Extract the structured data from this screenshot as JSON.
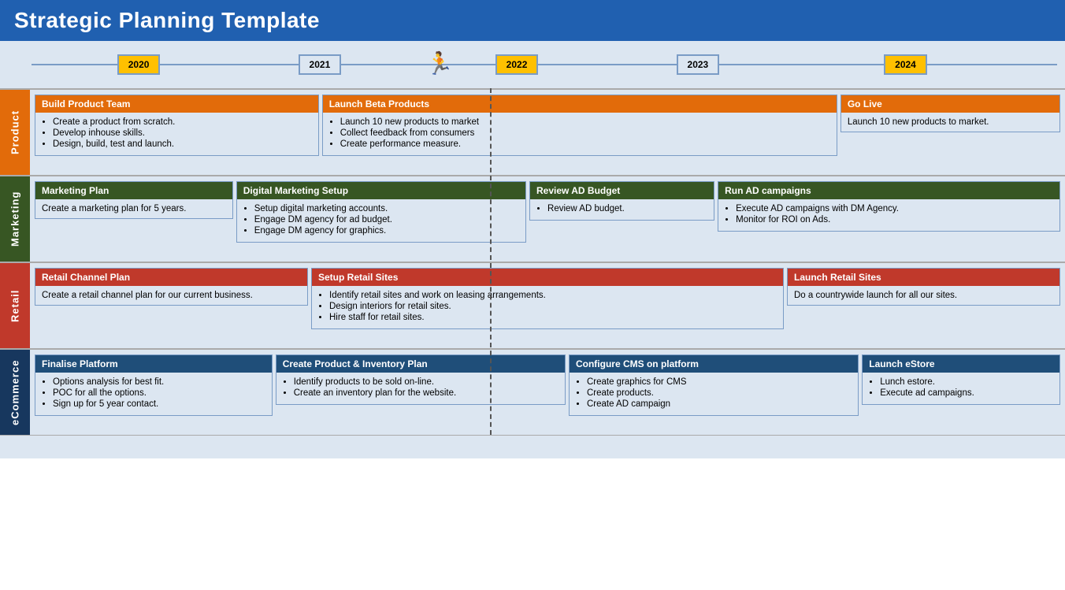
{
  "header": {
    "title": "Strategic Planning Template"
  },
  "timeline": {
    "years": [
      {
        "label": "2020",
        "style": "yellow",
        "left": "14%"
      },
      {
        "label": "2021",
        "style": "blue",
        "left": "31%"
      },
      {
        "label": "2022",
        "style": "yellow",
        "left": "49%"
      },
      {
        "label": "2023",
        "style": "blue",
        "left": "66%"
      },
      {
        "label": "2024",
        "style": "yellow",
        "left": "86%"
      }
    ],
    "runner_left": "42%"
  },
  "dashed_line_left": "44.5%",
  "rows": [
    {
      "id": "product",
      "label": "Product",
      "label_style": "orange",
      "cards": [
        {
          "header": "Build Product Team",
          "header_style": "orange",
          "body_type": "list",
          "items": [
            "Create a product from scratch.",
            "Develop inhouse skills.",
            "Design, build, test and launch."
          ]
        },
        {
          "header": "Launch Beta Products",
          "header_style": "orange",
          "body_type": "list",
          "items": [
            "Launch 10 new products to market",
            "Collect feedback from consumers",
            "Create performance measure."
          ]
        },
        {
          "header": "Go Live",
          "header_style": "orange",
          "body_type": "text",
          "text": "Launch 10 new products to market."
        }
      ]
    },
    {
      "id": "marketing",
      "label": "Marketing",
      "label_style": "green",
      "cards": [
        {
          "header": "Marketing Plan",
          "header_style": "green",
          "body_type": "text",
          "text": "Create a marketing plan for 5 years."
        },
        {
          "header": "Digital Marketing Setup",
          "header_style": "green",
          "body_type": "list",
          "items": [
            "Setup digital marketing accounts.",
            "Engage DM agency for ad budget.",
            "Engage DM agency for graphics."
          ]
        },
        {
          "header": "Review AD Budget",
          "header_style": "green",
          "body_type": "list",
          "items": [
            "Review AD budget."
          ]
        },
        {
          "header": "Run AD campaigns",
          "header_style": "green",
          "body_type": "list",
          "items": [
            "Execute AD campaigns with DM Agency.",
            "Monitor for ROI on Ads."
          ]
        }
      ]
    },
    {
      "id": "retail",
      "label": "Retail",
      "label_style": "red",
      "cards": [
        {
          "header": "Retail Channel Plan",
          "header_style": "red",
          "body_type": "text",
          "text": "Create a retail channel plan for our current business."
        },
        {
          "header": "Setup Retail Sites",
          "header_style": "red",
          "body_type": "list",
          "items": [
            "Identify retail sites and work on leasing arrangements.",
            "Design interiors for retail sites.",
            "Hire staff for retail sites."
          ]
        },
        {
          "header": "Launch Retail Sites",
          "header_style": "red",
          "body_type": "text",
          "text": "Do a countrywide launch for all our sites."
        }
      ]
    },
    {
      "id": "ecommerce",
      "label": "eCommerce",
      "label_style": "blue-label",
      "cards": [
        {
          "header": "Finalise Platform",
          "header_style": "blue-h",
          "body_type": "list",
          "items": [
            "Options analysis for best fit.",
            "POC for all the options.",
            "Sign up for 5 year contact."
          ]
        },
        {
          "header": "Create Product & Inventory Plan",
          "header_style": "blue-h",
          "body_type": "list",
          "items": [
            "Identify products to be sold on-line.",
            "Create an inventory plan for the website."
          ]
        },
        {
          "header": "Configure CMS on platform",
          "header_style": "blue-h",
          "body_type": "list",
          "items": [
            "Create graphics for CMS",
            "Create products.",
            "Create AD campaign"
          ]
        },
        {
          "header": "Launch eStore",
          "header_style": "blue-h",
          "body_type": "list",
          "items": [
            "Lunch estore.",
            "Execute ad campaigns."
          ]
        }
      ]
    }
  ]
}
